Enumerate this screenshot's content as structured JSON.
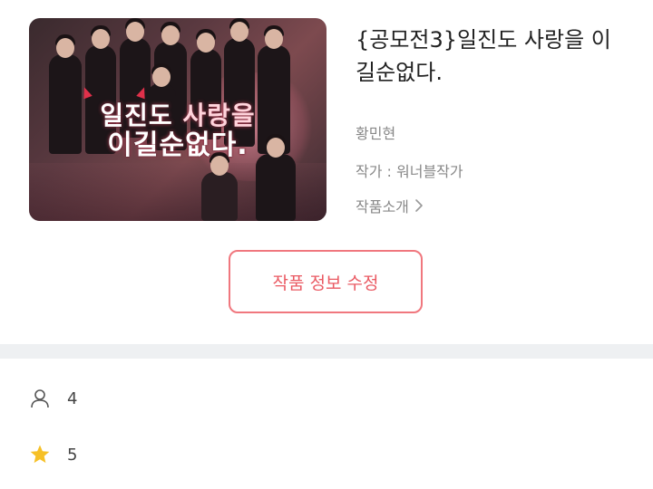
{
  "work": {
    "title": "{공모전3}일진도 사랑을 이길순없다.",
    "author_name": "황민현",
    "writer_label": "작가 : 워너블작가",
    "intro_link": "작품소개",
    "edit_button": "작품 정보 수정"
  },
  "cover": {
    "title_line1_a": "일진도",
    "title_line1_b": "사랑을",
    "title_line2": "이길순없다."
  },
  "stats": {
    "views": "4",
    "stars": "5"
  },
  "colors": {
    "accent": "#ea5a63",
    "star": "#f6c026",
    "divider": "#eef0f2"
  },
  "icons": {
    "views": "person-icon",
    "stars": "star-icon",
    "intro": "chevron-right-icon"
  }
}
